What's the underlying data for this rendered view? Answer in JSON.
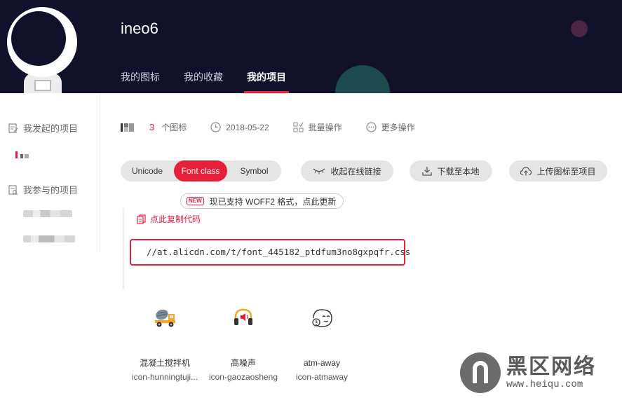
{
  "header": {
    "username": "ineo6",
    "tabs": [
      {
        "label": "我的图标"
      },
      {
        "label": "我的收藏"
      },
      {
        "label": "我的项目"
      }
    ]
  },
  "sidebar": {
    "my_projects_label": "我发起的项目",
    "joined_projects_label": "我参与的项目"
  },
  "project": {
    "icon_count": "3",
    "icon_count_unit": "个图标",
    "date": "2018-05-22",
    "batch_label": "批量操作",
    "more_label": "更多操作"
  },
  "format_tabs": [
    "Unicode",
    "Font class",
    "Symbol"
  ],
  "actions": {
    "collapse_link": "收起在线链接",
    "download": "下载至本地",
    "upload": "上传图标至项目"
  },
  "notice": {
    "badge": "NEW",
    "text": "现已支持 WOFF2 格式，点此更新"
  },
  "copy_code_label": "点此复制代码",
  "css_url": "//at.alicdn.com/t/font_445182_ptdfum3no8gxpqfr.css",
  "icons": [
    {
      "name": "混凝土搅拌机",
      "class": "icon-hunningtuji...",
      "icon": "concrete-mixer-icon"
    },
    {
      "name": "高噪声",
      "class": "icon-gaozaosheng",
      "icon": "high-noise-icon"
    },
    {
      "name": "atm-away",
      "class": "icon-atmaway",
      "icon": "atm-away-icon"
    }
  ],
  "watermark": {
    "cn": "黑区网络",
    "url": "www.heiqu.com"
  },
  "colors": {
    "accent": "#e6203b",
    "header_bg": "#11112b"
  }
}
